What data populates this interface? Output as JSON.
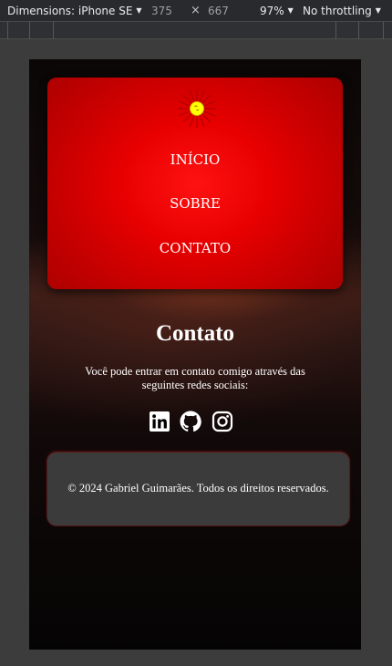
{
  "devtools": {
    "device_label": "Dimensions: iPhone SE",
    "width": "375",
    "times": "×",
    "height": "667",
    "zoom": "97%",
    "throttling": "No throttling"
  },
  "nav": {
    "items": [
      "INÍCIO",
      "SOBRE",
      "CONTATO"
    ]
  },
  "contact": {
    "title": "Contato",
    "text": "Você pode entrar em contato comigo através das seguintes redes sociais:"
  },
  "social": {
    "icons": [
      "linkedin-icon",
      "github-icon",
      "instagram-icon"
    ]
  },
  "footer": {
    "text": "© 2024 Gabriel Guimarães. Todos os direitos reservados."
  },
  "colors": {
    "nav_red": "#e80000",
    "footer_bg": "#3b3b3b",
    "sun_yellow": "#ffff00"
  }
}
